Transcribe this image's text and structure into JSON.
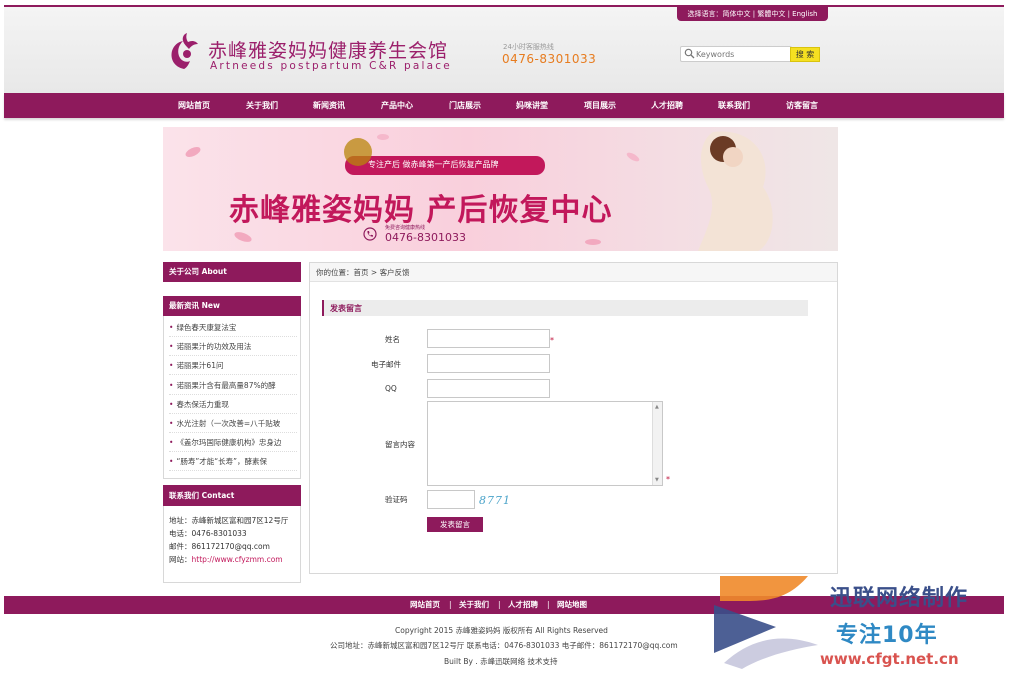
{
  "header": {
    "lang": "选择语言：简体中文 | 繁體中文 | English",
    "logo_cn": "赤峰雅姿妈妈健康养生会馆",
    "logo_en": "Artneeds postpartum C&R palace",
    "hotline_label": "24小时客服热线",
    "hotline": "0476-8301033",
    "search_placeholder": "Keywords",
    "search_button": "搜 索"
  },
  "nav": [
    "网站首页",
    "关于我们",
    "新闻资讯",
    "产品中心",
    "门店展示",
    "妈咪讲堂",
    "项目展示",
    "人才招聘",
    "联系我们",
    "访客留言"
  ],
  "banner": {
    "slogan": "专注产后   做赤峰第一产后恢复产品牌",
    "headline": "赤峰雅姿妈妈 产后恢复中心",
    "phone_label": "免费咨询健康热线",
    "phone": "0476-8301033"
  },
  "sidebar": {
    "about_title": "关于公司   About",
    "news_title": "最新资讯   New",
    "news": [
      "绿色春天康复法宝",
      "诺丽果汁的功效及用法",
      "诺丽果汁61问",
      "诺丽果汁含有最高量87%的酵",
      "春杰保活力重现",
      "水光注射（一次改善=八千贴玻",
      "《盖尔玛国际健康机构》忠身边",
      "“肠寿”才能“长寿”，酵素保"
    ],
    "contact_title": "联系我们   Contact",
    "contact": {
      "address": "地址：赤峰新城区富和园7区12号厅",
      "phone": "电话：0476-8301033",
      "email": "邮件：861172170@qq.com",
      "site_label": "网站：",
      "site_url": "http://www.cfyzmm.com"
    }
  },
  "main": {
    "crumb_prefix": "你的位置：",
    "crumb_home": "首页",
    "crumb_sep": " > ",
    "crumb_current": "客户反馈",
    "form_title": "发表留言",
    "labels": {
      "name": "姓名",
      "email": "电子邮件",
      "qq": "QQ",
      "message": "留言内容",
      "captcha": "验证码"
    },
    "captcha_code": "8771",
    "submit": "发表留言",
    "required": "*"
  },
  "footer": {
    "links": [
      "网站首页",
      "关于我们",
      "人才招聘",
      "网站地图"
    ],
    "sep": "|",
    "copyright": "Copyright 2015 赤峰雅姿妈妈 版权所有 All Rights Reserved",
    "address": "公司地址：赤峰新城区富和园7区12号厅 联系电话：0476-8301033 电子邮件：861172170@qq.com",
    "built": "Built By . 赤峰迅联网络 技术支持"
  },
  "watermark": {
    "title": "迅联网络制作",
    "sub": "专注10年",
    "url": "www.cfgt.net.cn"
  },
  "colors": {
    "brand": "#8e1a5c",
    "accent": "#e77c1f",
    "search_button": "#f5e021"
  }
}
